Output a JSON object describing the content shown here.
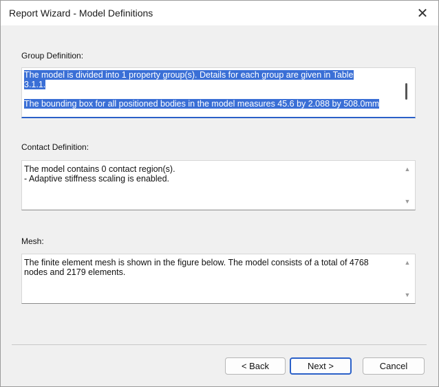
{
  "window": {
    "title": "Report Wizard - Model Definitions",
    "close_glyph": "✕"
  },
  "group": {
    "label": "Group Definition:",
    "lines": [
      "The model is divided into 1 property group(s). Details for each group are given in Table",
      "3.1.1.",
      "The bounding box for all positioned bodies in the model measures 45.6 by 2.088 by 508.0mm"
    ]
  },
  "contact": {
    "label": "Contact Definition:",
    "lines": [
      "The model contains 0 contact region(s).",
      "- Adaptive stiffness scaling is enabled."
    ]
  },
  "mesh": {
    "label": "Mesh:",
    "lines": [
      "The finite element mesh is shown in the figure below. The model consists of a total of  4768",
      "nodes and  2179 elements."
    ]
  },
  "icons": {
    "scroll_up": "▲",
    "scroll_down": "▼"
  },
  "buttons": {
    "back": "< Back",
    "next": "Next >",
    "cancel": "Cancel"
  }
}
